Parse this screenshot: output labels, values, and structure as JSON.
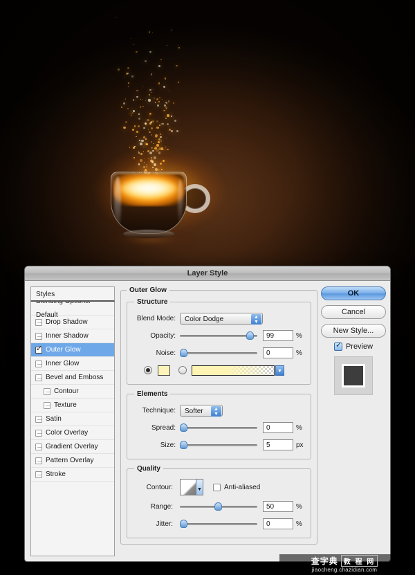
{
  "artwork": {
    "description": "glowing coffee cup with rising sparks",
    "background_color": "#2b1708",
    "glow_color": "#ffc244"
  },
  "dialog": {
    "title": "Layer Style",
    "styles_panel": {
      "header": "Styles",
      "blending_options": "Blending Options: Default",
      "items": [
        {
          "label": "Drop Shadow",
          "checked": false,
          "indent": false
        },
        {
          "label": "Inner Shadow",
          "checked": false,
          "indent": false
        },
        {
          "label": "Outer Glow",
          "checked": true,
          "indent": false
        },
        {
          "label": "Inner Glow",
          "checked": false,
          "indent": false
        },
        {
          "label": "Bevel and Emboss",
          "checked": false,
          "indent": false
        },
        {
          "label": "Contour",
          "checked": false,
          "indent": true
        },
        {
          "label": "Texture",
          "checked": false,
          "indent": true
        },
        {
          "label": "Satin",
          "checked": false,
          "indent": false
        },
        {
          "label": "Color Overlay",
          "checked": false,
          "indent": false
        },
        {
          "label": "Gradient Overlay",
          "checked": false,
          "indent": false
        },
        {
          "label": "Pattern Overlay",
          "checked": false,
          "indent": false
        },
        {
          "label": "Stroke",
          "checked": false,
          "indent": false
        }
      ],
      "selected": "Outer Glow"
    },
    "outer_glow": {
      "section_title": "Outer Glow",
      "structure": {
        "title": "Structure",
        "blend_mode_label": "Blend Mode:",
        "blend_mode_value": "Color Dodge",
        "opacity_label": "Opacity:",
        "opacity_value": "99",
        "opacity_unit": "%",
        "noise_label": "Noise:",
        "noise_value": "0",
        "noise_unit": "%",
        "color_mode": "solid",
        "solid_color": "#fdf3b8",
        "gradient_from": "#fdf4b4",
        "gradient_to": "transparent"
      },
      "elements": {
        "title": "Elements",
        "technique_label": "Technique:",
        "technique_value": "Softer",
        "spread_label": "Spread:",
        "spread_value": "0",
        "spread_unit": "%",
        "size_label": "Size:",
        "size_value": "5",
        "size_unit": "px"
      },
      "quality": {
        "title": "Quality",
        "contour_label": "Contour:",
        "anti_aliased_label": "Anti-aliased",
        "anti_aliased_checked": false,
        "range_label": "Range:",
        "range_value": "50",
        "range_unit": "%",
        "jitter_label": "Jitter:",
        "jitter_value": "0",
        "jitter_unit": "%"
      }
    },
    "buttons": {
      "ok": "OK",
      "cancel": "Cancel",
      "new_style": "New Style...",
      "preview_label": "Preview",
      "preview_checked": true
    }
  },
  "watermark": {
    "brand": "查字典",
    "brand2": "教 程 网",
    "url": "jiaocheng.chazidian.com"
  }
}
